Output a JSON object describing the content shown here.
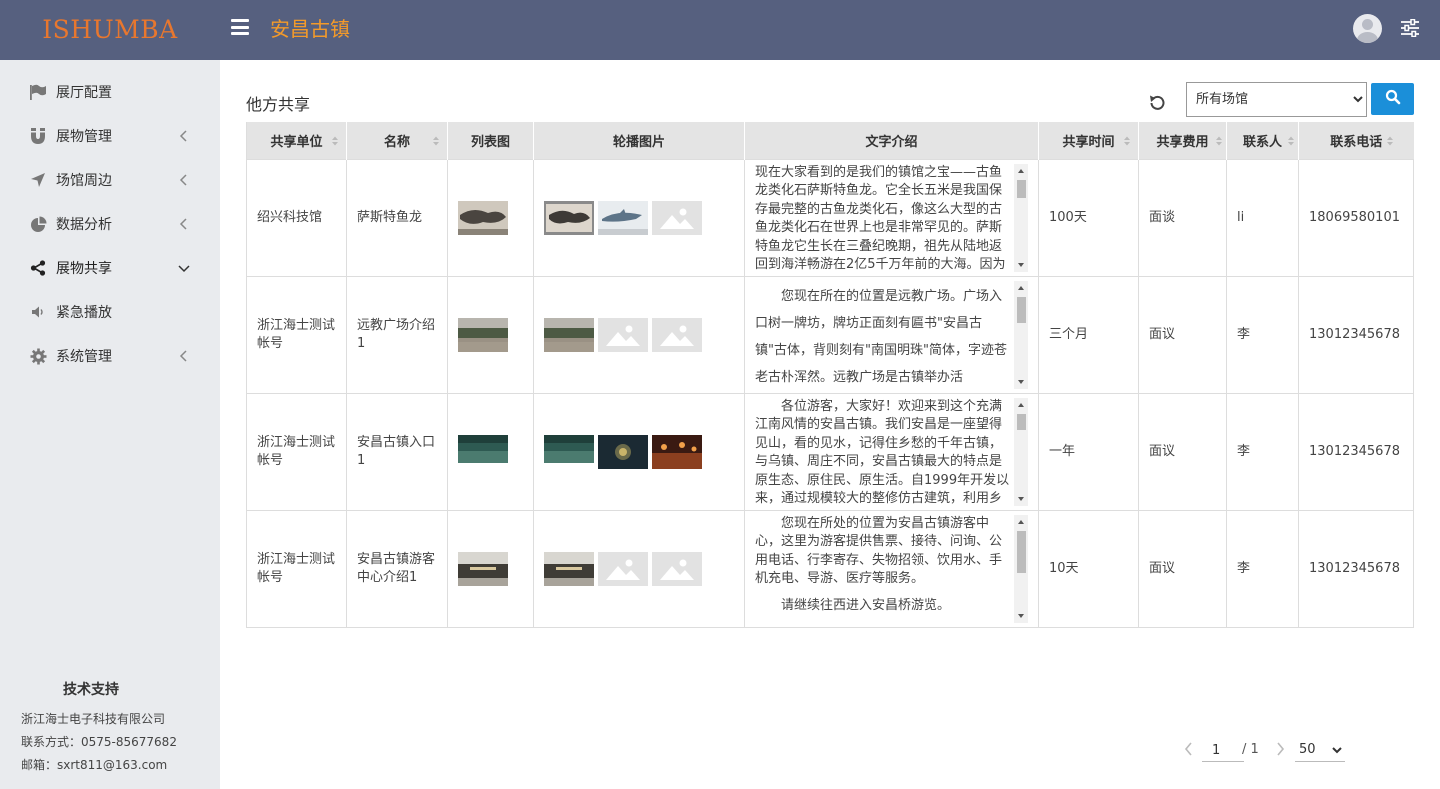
{
  "header": {
    "logo": "ISHUMBA",
    "title": "安昌古镇"
  },
  "sidebar": {
    "items": [
      {
        "label": "展厅配置",
        "icon": "flag-icon"
      },
      {
        "label": "展物管理",
        "icon": "magnet-icon"
      },
      {
        "label": "场馆周边",
        "icon": "location-arrow-icon"
      },
      {
        "label": "数据分析",
        "icon": "pie-chart-icon"
      },
      {
        "label": "展物共享",
        "icon": "share-icon"
      },
      {
        "label": "紧急播放",
        "icon": "volume-icon"
      },
      {
        "label": "系统管理",
        "icon": "gear-icon"
      }
    ],
    "support": {
      "title": "技术支持",
      "company": "浙江海士电子科技有限公司",
      "contact": "联系方式：0575-85677682",
      "email": "邮箱：sxrt811@163.com"
    }
  },
  "main": {
    "section_title": "他方共享",
    "venue_select": "所有场馆",
    "columns": [
      "共享单位",
      "名称",
      "列表图",
      "轮播图片",
      "文字介绍",
      "共享时间",
      "共享费用",
      "联系人",
      "联系电话"
    ],
    "rows": [
      {
        "unit": "绍兴科技馆",
        "name": "萨斯特鱼龙",
        "intro": "现在大家看到的是我们的镇馆之宝——古鱼龙类化石萨斯特鱼龙。它全长五米是我国保存最完整的古鱼龙类化石，像这么大型的古鱼龙类化石在世界上也是非常罕见的。萨斯特鱼龙它生长在三叠纪晚期，祖先从陆地返回到海洋畅游在2亿5千万年前的大海。因为地",
        "time": "100天",
        "fee": "面谈",
        "contact": "li",
        "phone": "18069580101"
      },
      {
        "unit": "浙江海士测试帐号",
        "name": "远教广场介绍1",
        "intro": "您现在所在的位置是远教广场。广场入口树一牌坊，牌坊正面刻有匾书\"安昌古镇\"古体，背则刻有\"南国明珠\"简体，字迹苍老古朴浑然。远教广场是古镇举办活",
        "time": "三个月",
        "fee": "面议",
        "contact": "李",
        "phone": "13012345678"
      },
      {
        "unit": "浙江海士测试帐号",
        "name": "安昌古镇入口1",
        "intro": "各位游客，大家好！欢迎来到这个充满江南风情的安昌古镇。我们安昌是一座望得见山，看的见水，记得住乡愁的千年古镇，与乌镇、周庄不同，安昌古镇最大的特点是原生态、原住民、原生活。自1999年开发以来，通过规模较大的整修仿古建筑，利用乡",
        "time": "一年",
        "fee": "面议",
        "contact": "李",
        "phone": "13012345678"
      },
      {
        "unit": "浙江海士测试帐号",
        "name": "安昌古镇游客中心介绍1",
        "intro": "您现在所处的位置为安昌古镇游客中心，这里为游客提供售票、接待、问询、公用电话、行李寄存、失物招领、饮用水、手机充电、导游、医疗等服务。",
        "intro2": "请继续往西进入安昌桥游览。",
        "time": "10天",
        "fee": "面议",
        "contact": "李",
        "phone": "13012345678"
      }
    ]
  },
  "pagination": {
    "current": "1",
    "total": "/ 1",
    "page_size": "50"
  },
  "colors": {
    "topbar": "#56607f",
    "logo": "#e8772e",
    "title": "#f39a2a",
    "sidebar": "#e9ebee",
    "search_button": "#1b8fd9"
  }
}
